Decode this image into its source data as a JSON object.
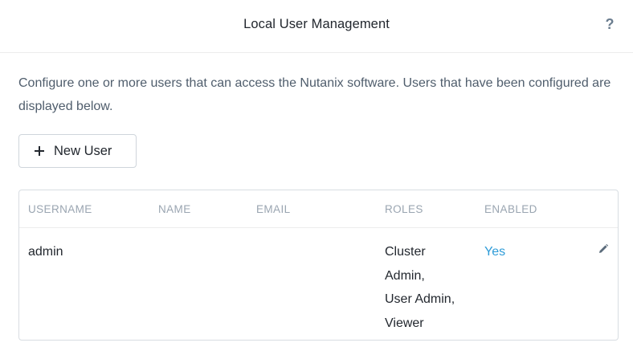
{
  "dialog": {
    "title": "Local User Management",
    "help_label": "?"
  },
  "description": "Configure one or more users that can access the Nutanix software. Users that have been configured are displayed below.",
  "toolbar": {
    "new_user_label": "New User",
    "new_user_icon": "plus-icon"
  },
  "table": {
    "columns": [
      "USERNAME",
      "NAME",
      "EMAIL",
      "ROLES",
      "ENABLED"
    ],
    "rows": [
      {
        "username": "admin",
        "name": "",
        "email": "",
        "roles": [
          "Cluster",
          "Admin,",
          "User Admin,",
          "Viewer"
        ],
        "enabled": "Yes",
        "action_icon": "pencil-edit-icon"
      }
    ]
  },
  "colors": {
    "link": "#2f9cd8",
    "muted_header": "#9aa5b1",
    "text": "#22272e",
    "border": "#d8dde2"
  }
}
